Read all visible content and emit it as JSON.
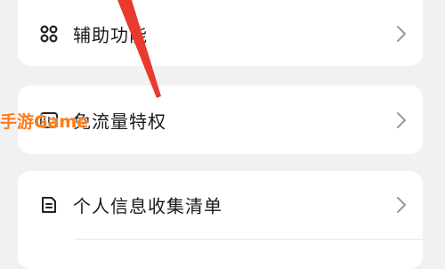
{
  "settings": {
    "items": [
      {
        "label": "辅助功能",
        "icon": "grid-command-icon"
      },
      {
        "label": "免流量特权",
        "icon": "traffic-gift-icon"
      },
      {
        "label": "个人信息收集清单",
        "icon": "document-list-icon"
      }
    ]
  },
  "watermark": {
    "text": "手游Game"
  },
  "colors": {
    "background": "#f1f1f3",
    "card": "#ffffff",
    "arrow": "#e83a2e",
    "watermark": "#ff7a18"
  }
}
